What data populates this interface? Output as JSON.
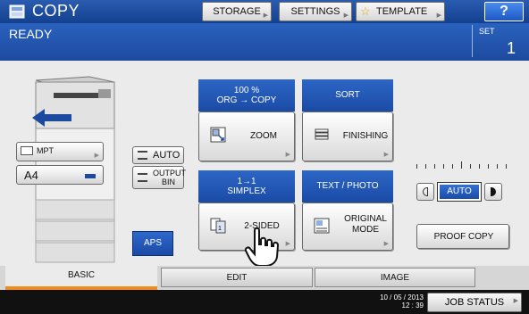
{
  "app": {
    "title": "COPY"
  },
  "top_buttons": {
    "storage": "STORAGE",
    "settings": "SETTINGS",
    "template": "TEMPLATE",
    "help": "?"
  },
  "header": {
    "status": "READY",
    "set_label": "SET",
    "set_value": "1"
  },
  "paper": {
    "mpt_label": "MPT",
    "size": "A4"
  },
  "auto_button": "AUTO",
  "output_bin": {
    "line1": "OUTPUT",
    "line2": "BIN"
  },
  "aps_button": "APS",
  "zoom": {
    "header_line1": "100 %",
    "header_line2": "ORG → COPY",
    "label": "ZOOM"
  },
  "finishing": {
    "header": "SORT",
    "label": "FINISHING"
  },
  "two_sided": {
    "header_line1": "1→1",
    "header_line2": "SIMPLEX",
    "label": "2-SIDED"
  },
  "original_mode": {
    "header": "TEXT / PHOTO",
    "label_line1": "ORIGINAL",
    "label_line2": "MODE"
  },
  "density": {
    "auto_label": "AUTO",
    "level": 0.5
  },
  "proof_copy": "PROOF COPY",
  "tabs": {
    "basic": "BASIC",
    "edit": "EDIT",
    "image": "IMAGE"
  },
  "footer": {
    "date": "10 / 05 / 2013",
    "time": "12 : 39",
    "job_status": "JOB STATUS"
  },
  "colors": {
    "accent_blue": "#1c4a9f",
    "active_tab_underline": "#f08a1a",
    "header_blue": "#2a62be"
  }
}
